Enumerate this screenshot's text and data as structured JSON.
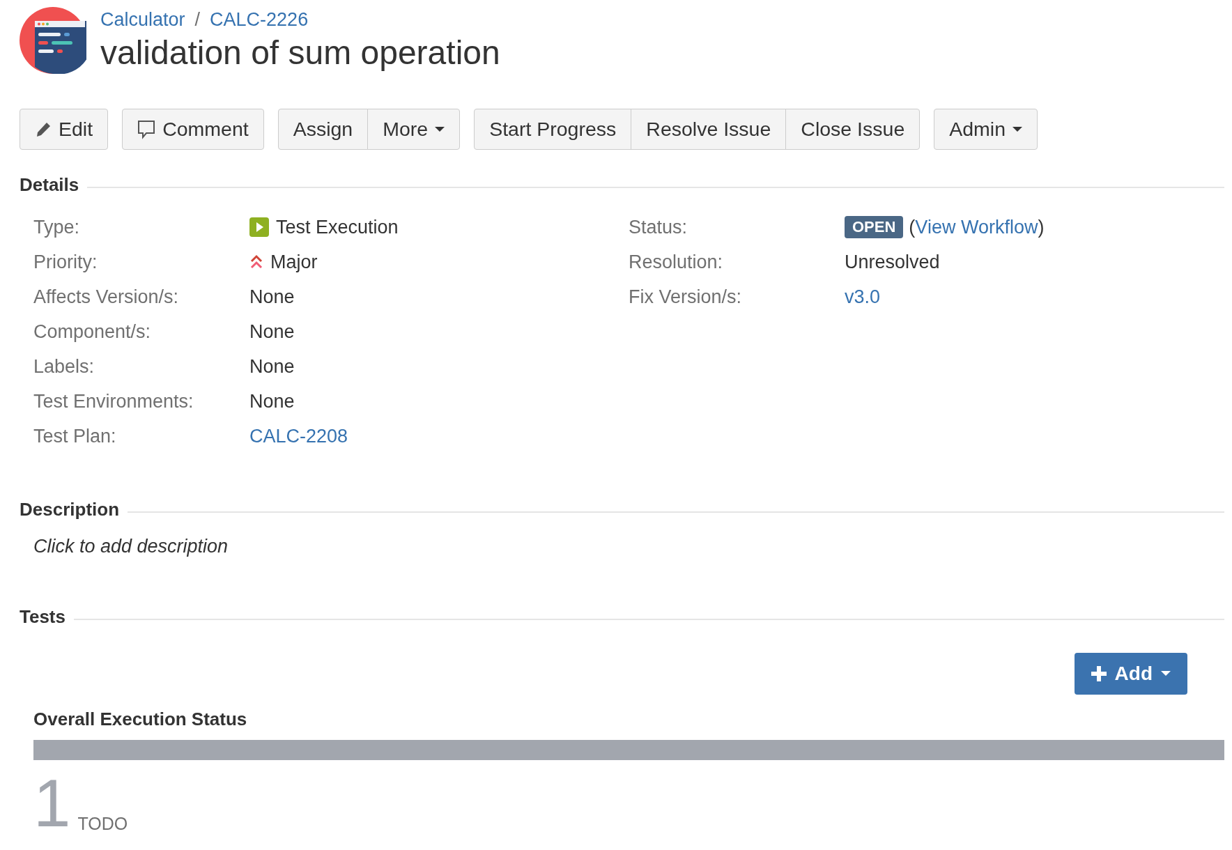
{
  "header": {
    "breadcrumbs": [
      "Calculator",
      "CALC-2226"
    ],
    "separator": "/",
    "title": "validation of sum operation"
  },
  "toolbar": [
    [
      {
        "label": "Edit",
        "kind": "edit"
      }
    ],
    [
      {
        "label": "Comment",
        "kind": "comment"
      }
    ],
    [
      {
        "label": "Assign",
        "kind": "plain"
      },
      {
        "label": "More",
        "kind": "dropdown"
      }
    ],
    [
      {
        "label": "Start Progress",
        "kind": "plain"
      },
      {
        "label": "Resolve Issue",
        "kind": "plain"
      },
      {
        "label": "Close Issue",
        "kind": "plain"
      }
    ],
    [
      {
        "label": "Admin",
        "kind": "dropdown"
      }
    ]
  ],
  "details": {
    "heading": "Details",
    "left": [
      {
        "label": "Type:",
        "kind": "issue-type",
        "value": "Test Execution"
      },
      {
        "label": "Priority:",
        "kind": "priority",
        "value": "Major"
      },
      {
        "label": "Affects Version/s:",
        "kind": "text",
        "value": "None"
      },
      {
        "label": "Component/s:",
        "kind": "text",
        "value": "None"
      },
      {
        "label": "Labels:",
        "kind": "text",
        "value": "None"
      },
      {
        "label": "Test Environments:",
        "kind": "text",
        "value": "None"
      },
      {
        "label": "Test Plan:",
        "kind": "link",
        "value": "CALC-2208"
      }
    ],
    "right": [
      {
        "label": "Status:",
        "kind": "status",
        "value": "OPEN",
        "open_paren": "(",
        "link": "View Workflow",
        "close_paren": ")"
      },
      {
        "label": "Resolution:",
        "kind": "text",
        "value": "Unresolved"
      },
      {
        "label": "Fix Version/s:",
        "kind": "link",
        "value": "v3.0"
      }
    ]
  },
  "description": {
    "heading": "Description",
    "placeholder": "Click to add description"
  },
  "tests": {
    "heading": "Tests",
    "add_button": "Add",
    "overall_title": "Overall Execution Status",
    "segments": [
      {
        "label": "TODO",
        "count": "1",
        "color": "#a2a6ae"
      }
    ]
  }
}
